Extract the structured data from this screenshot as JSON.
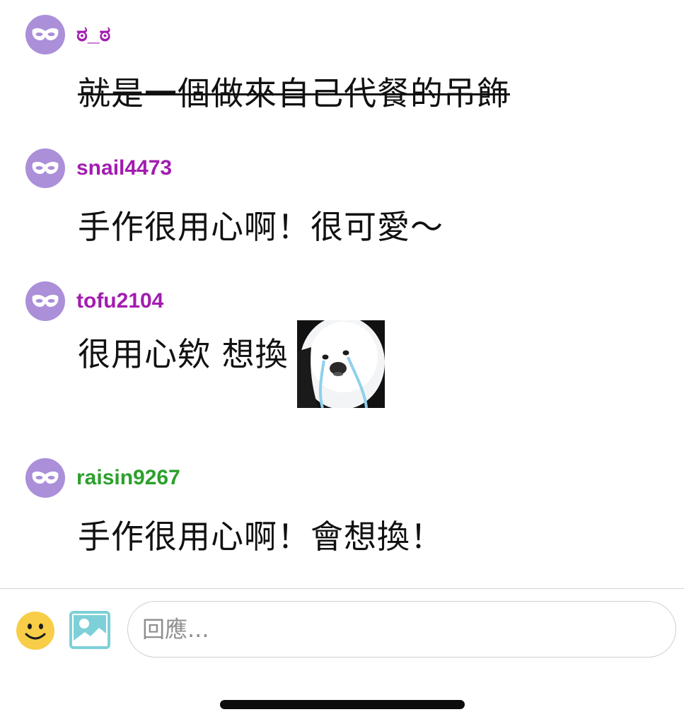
{
  "colors": {
    "avatar_bg": "#ab8fd9",
    "username_purple": "#a21caf",
    "username_green": "#2ca02c",
    "emoji_face": "#f8cd47",
    "image_icon": "#7ed0d8"
  },
  "comments": [
    {
      "username": "ಠ_ಠ",
      "username_color": "#a21caf",
      "text": "就是一個做來自己代餐的吊飾",
      "strikethrough": true,
      "avatar_icon": "mask-icon"
    },
    {
      "username": "snail4473",
      "username_color": "#a21caf",
      "text": "手作很用心啊！很可愛～",
      "strikethrough": false,
      "avatar_icon": "mask-icon"
    },
    {
      "username": "tofu2104",
      "username_color": "#a21caf",
      "text": "很用心欸 想換",
      "strikethrough": false,
      "sticker": "crying-seal-sticker",
      "avatar_icon": "mask-icon"
    },
    {
      "username": "raisin9267",
      "username_color": "#2ca02c",
      "text": "手作很用心啊！會想換！",
      "strikethrough": false,
      "avatar_icon": "mask-icon"
    }
  ],
  "reply_bar": {
    "placeholder": "回應...",
    "value": "",
    "emoji_icon": "smiley-icon",
    "image_icon": "image-icon"
  }
}
